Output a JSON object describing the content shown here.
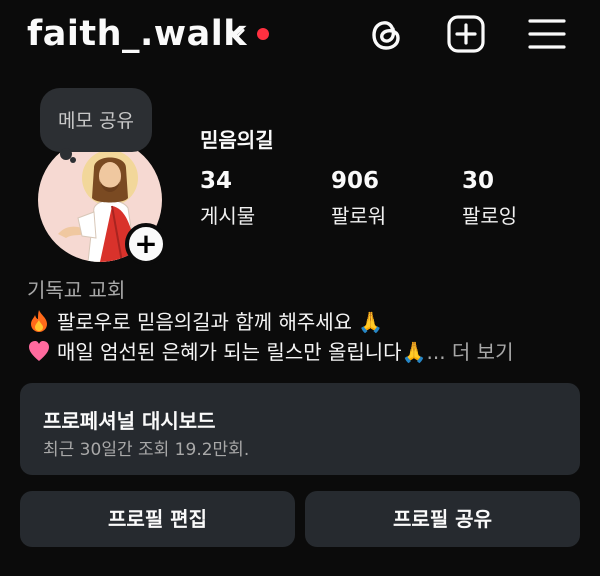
{
  "header": {
    "username": "faith_.walk",
    "icons": [
      "chevron-down-icon",
      "notification-dot",
      "threads-icon",
      "create-icon",
      "menu-icon"
    ],
    "notification_color": "#ff3040"
  },
  "profile": {
    "memo_label": "메모 공유",
    "display_name": "믿음의길",
    "stats": [
      {
        "value": "34",
        "label": "게시물"
      },
      {
        "value": "906",
        "label": "팔로워"
      },
      {
        "value": "30",
        "label": "팔로잉"
      }
    ],
    "category": "기독교 교회",
    "bio_line1": "팔로우로 믿음의길과 함께 해주세요 🙏",
    "bio_line2": "매일 엄선된 은혜가 되는 릴스만 올립니다🙏",
    "more": "... 더 보기"
  },
  "dashboard": {
    "title": "프로페셔널 대시보드",
    "subtitle": "최근 30일간 조회 19.2만회."
  },
  "buttons": {
    "edit_profile": "프로필 편집",
    "share_profile": "프로필 공유"
  }
}
